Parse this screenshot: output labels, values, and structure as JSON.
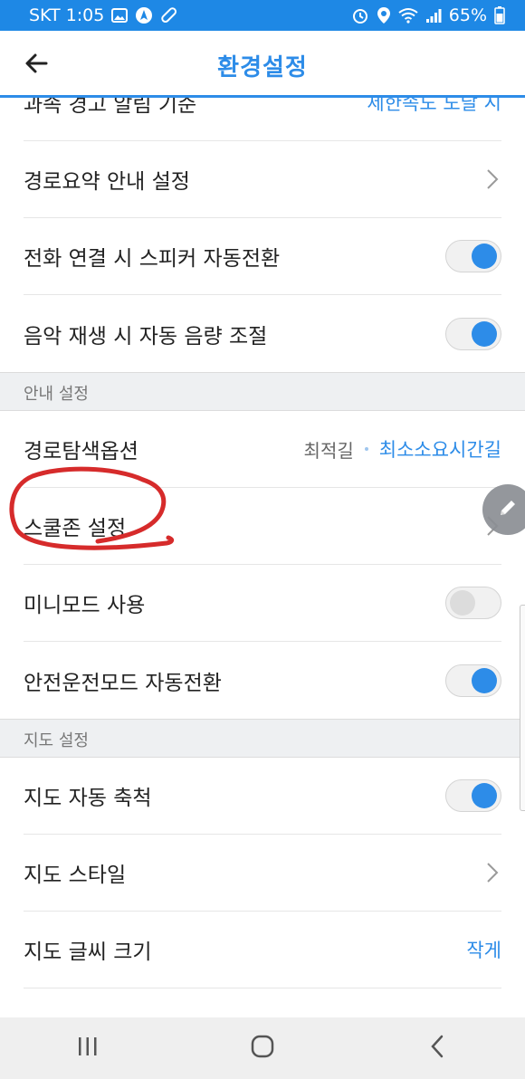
{
  "status_bar": {
    "carrier_time": "SKT 1:05",
    "battery": "65%"
  },
  "header": {
    "title": "환경설정"
  },
  "settings": {
    "cutoff_row": {
      "label": "과속 경고 알림 기준",
      "value": "제한속도 도달 시"
    },
    "route_summary": {
      "label": "경로요약 안내 설정"
    },
    "speaker_switch": {
      "label": "전화 연결 시 스피커 자동전환",
      "enabled": true
    },
    "music_volume": {
      "label": "음악 재생 시 자동 음량 조절",
      "enabled": true
    },
    "guidance_section": "안내 설정",
    "route_option": {
      "label": "경로탐색옵션",
      "option_1": "최적길",
      "option_2": "최소소요시간길"
    },
    "school_zone": {
      "label": "스쿨존 설정"
    },
    "mini_mode": {
      "label": "미니모드 사용",
      "enabled": false
    },
    "safe_drive": {
      "label": "안전운전모드 자동전환",
      "enabled": true
    },
    "map_section": "지도 설정",
    "map_auto_scale": {
      "label": "지도 자동 축척",
      "enabled": true
    },
    "map_style": {
      "label": "지도 스타일"
    },
    "map_font_size": {
      "label": "지도 글씨 크기",
      "value": "작게"
    }
  },
  "colors": {
    "accent": "#2d8ce8",
    "status_bar": "#1e88e5",
    "annotation": "#d62b2b"
  },
  "icons": [
    "back-arrow-icon",
    "chevron-right-icon",
    "pencil-icon",
    "recent-apps-icon",
    "home-icon",
    "back-nav-icon"
  ]
}
